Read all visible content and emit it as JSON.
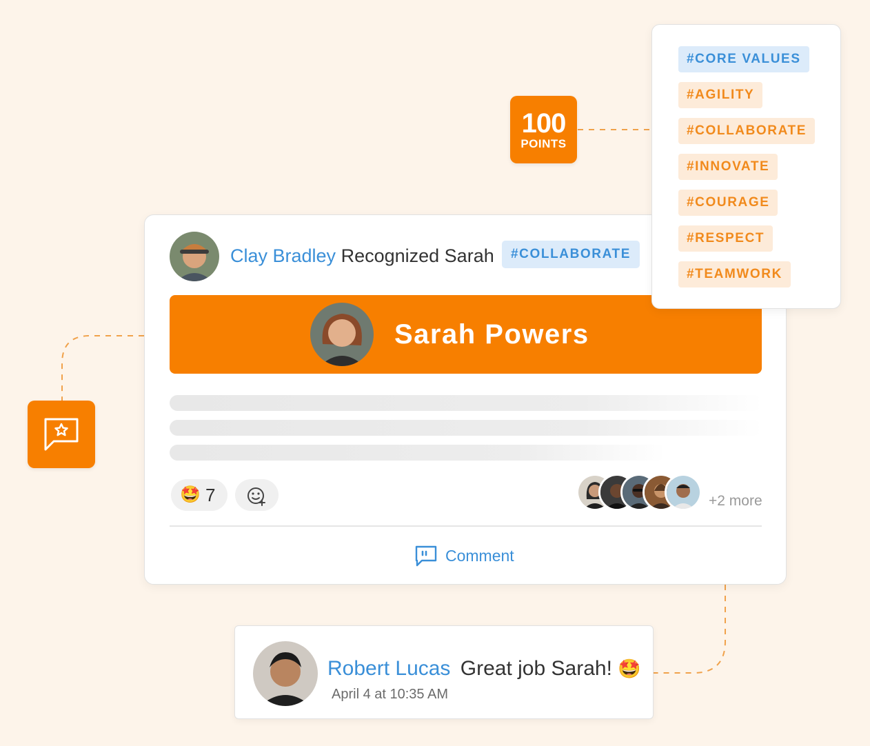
{
  "points": {
    "value": "100",
    "label": "POINTS"
  },
  "core_values": {
    "heading": "#CORE VALUES",
    "tags": [
      "#AGILITY",
      "#COLLABORATE",
      "#INNOVATE",
      "#COURAGE",
      "#RESPECT",
      "#TEAMWORK"
    ]
  },
  "post": {
    "poster_name": "Clay Bradley",
    "action_text": "Recognized Sarah",
    "value_tag": "#COLLABORATE",
    "recipient_name": "Sarah Powers",
    "reaction_emoji": "🤩",
    "reaction_count": "7",
    "more_text": "+2 more",
    "comment_label": "Comment"
  },
  "comment": {
    "author": "Robert Lucas",
    "text": "Great job Sarah!",
    "emoji": "🤩",
    "timestamp": "April 4 at 10:35 AM"
  },
  "colors": {
    "accent_orange": "#f77f00",
    "link_blue": "#3a8fd8",
    "background": "#fdf4ea"
  }
}
